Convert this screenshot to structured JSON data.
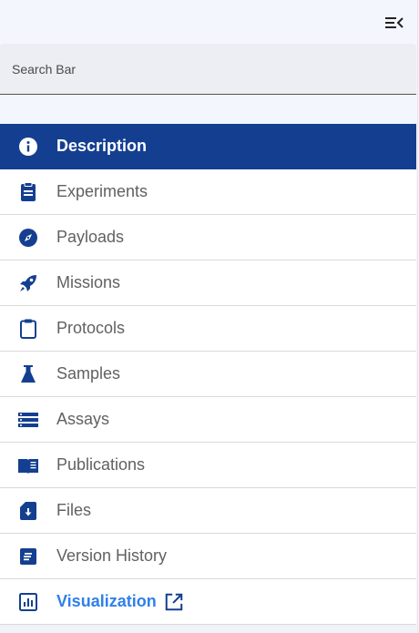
{
  "search": {
    "placeholder": "Search Bar",
    "value": ""
  },
  "nav": {
    "items": [
      {
        "label": "Description",
        "icon": "info-circle-icon",
        "active": true
      },
      {
        "label": "Experiments",
        "icon": "clipboard-list-icon"
      },
      {
        "label": "Payloads",
        "icon": "compass-icon"
      },
      {
        "label": "Missions",
        "icon": "rocket-icon"
      },
      {
        "label": "Protocols",
        "icon": "clipboard-icon"
      },
      {
        "label": "Samples",
        "icon": "flask-icon"
      },
      {
        "label": "Assays",
        "icon": "list-bars-icon"
      },
      {
        "label": "Publications",
        "icon": "book-open-icon"
      },
      {
        "label": "Files",
        "icon": "file-download-icon"
      },
      {
        "label": "Version History",
        "icon": "history-note-icon"
      },
      {
        "label": "Visualization",
        "icon": "bar-chart-icon",
        "external": true
      }
    ]
  },
  "colors": {
    "active_bg": "#143f91",
    "icon": "#143f91",
    "link": "#2f80ea",
    "label": "#616161"
  }
}
